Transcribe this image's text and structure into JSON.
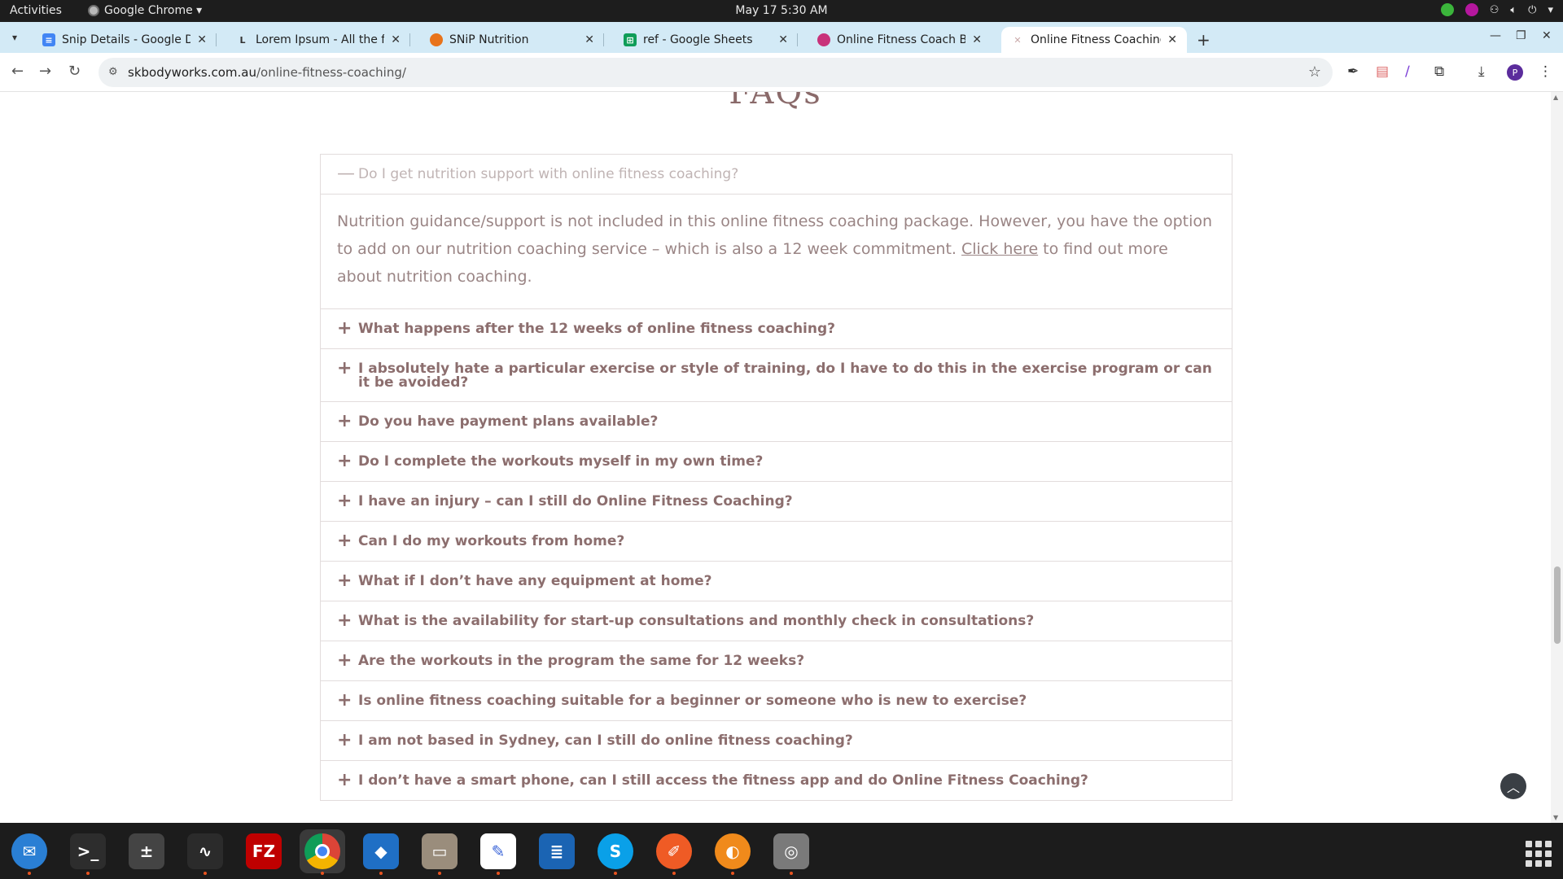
{
  "system_bar": {
    "activities": "Activities",
    "app_name": "Google Chrome ▾",
    "datetime": "May 17  5:30 AM"
  },
  "tabs": [
    {
      "title": "Snip Details - Google Do",
      "favicon": "docs-icon",
      "color": "#4285f4"
    },
    {
      "title": "Lorem Ipsum - All the fac",
      "favicon": "lorem-l-icon",
      "color": "#ffffff"
    },
    {
      "title": "SNiP Nutrition",
      "favicon": "snip-icon",
      "color": "#e8731a"
    },
    {
      "title": "ref - Google Sheets",
      "favicon": "sheets-icon",
      "color": "#0f9d58"
    },
    {
      "title": "Online Fitness Coach Bri",
      "favicon": "canva-icon",
      "color": "#c8327a"
    },
    {
      "title": "Online Fitness Coaching",
      "favicon": "site-icon",
      "color": "#d9c2c2"
    }
  ],
  "address_bar": {
    "domain": "skbodyworks.com.au",
    "path": "/online-fitness-coaching/"
  },
  "page": {
    "heading": "FAQs",
    "faq_items": [
      {
        "question": "Do I get nutrition support with online fitness coaching?",
        "open": true,
        "answer_before_link": "Nutrition guidance/support is not included in this online fitness coaching package. However, you have the option to add on our nutrition coaching service – which is also a 12 week commitment. ",
        "answer_link": "Click here",
        "answer_after_link": " to find out more about nutrition coaching."
      },
      {
        "question": "What happens after the 12 weeks of online fitness coaching?",
        "open": false
      },
      {
        "question": "I absolutely hate a particular exercise or style of training, do I have to do this in the exercise program or can it be avoided?",
        "open": false
      },
      {
        "question": "Do you have payment plans available?",
        "open": false
      },
      {
        "question": "Do I complete the workouts myself in my own time?",
        "open": false
      },
      {
        "question": "I have an injury – can I still do Online Fitness Coaching?",
        "open": false
      },
      {
        "question": "Can I do my workouts from home?",
        "open": false
      },
      {
        "question": "What if I don’t have any equipment at home?",
        "open": false
      },
      {
        "question": "What is the availability for start-up consultations and monthly check in consultations?",
        "open": false
      },
      {
        "question": "Are the workouts in the program the same for 12 weeks?",
        "open": false
      },
      {
        "question": "Is online fitness coaching suitable for a beginner or someone who is new to exercise?",
        "open": false
      },
      {
        "question": "I am not based in Sydney, can I still do online fitness coaching?",
        "open": false
      },
      {
        "question": "I don’t have a smart phone, can I still access the fitness app and do Online Fitness Coaching?",
        "open": false
      }
    ],
    "colors": {
      "question_text": "#8c6e6e",
      "open_question_text": "#c0b4b4",
      "answer_text": "#9a8585"
    }
  },
  "dock": [
    {
      "name": "thunderbird",
      "color": "#2a7fd4",
      "glyph": "✉",
      "dot": true
    },
    {
      "name": "terminal",
      "color": "#2d2d2d",
      "glyph": ">_",
      "dot": true
    },
    {
      "name": "calculator",
      "color": "#444444",
      "glyph": "±",
      "dot": false
    },
    {
      "name": "system-monitor",
      "color": "#2b2b2b",
      "glyph": "∿",
      "dot": true
    },
    {
      "name": "filezilla",
      "color": "#bf0000",
      "glyph": "FZ",
      "dot": false
    },
    {
      "name": "chrome",
      "color": "#ffffff",
      "glyph": "",
      "dot": true,
      "active": true
    },
    {
      "name": "vscode",
      "color": "#1f6fc5",
      "glyph": "◆",
      "dot": true
    },
    {
      "name": "files",
      "color": "#9a8d7c",
      "glyph": "▭",
      "dot": true
    },
    {
      "name": "text-editor",
      "color": "#ffffff",
      "glyph": "✎",
      "dot": true
    },
    {
      "name": "libreoffice-writer",
      "color": "#1b64b3",
      "glyph": "≣",
      "dot": false
    },
    {
      "name": "skype",
      "color": "#0aa0e8",
      "glyph": "S",
      "dot": true
    },
    {
      "name": "postman",
      "color": "#ef5b25",
      "glyph": "✐",
      "dot": true
    },
    {
      "name": "burner",
      "color": "#f08a1b",
      "glyph": "◐",
      "dot": true
    },
    {
      "name": "disk",
      "color": "#7a7a7a",
      "glyph": "◎",
      "dot": true
    }
  ]
}
